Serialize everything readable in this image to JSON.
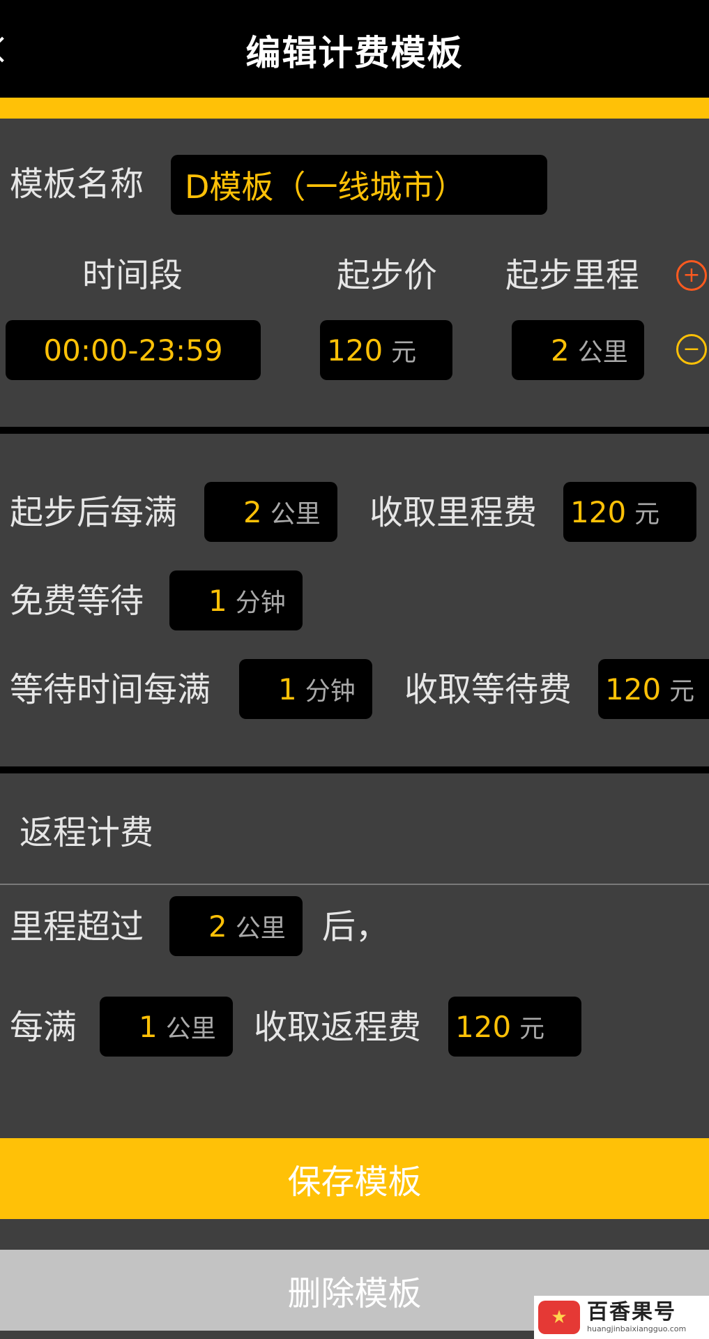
{
  "header": {
    "title": "编辑计费模板"
  },
  "template": {
    "label": "模板名称",
    "name": "D模板（一线城市）"
  },
  "columns": {
    "time": "时间段",
    "start_price": "起步价",
    "start_distance": "起步里程"
  },
  "row": {
    "time": "00:00-23:59",
    "price": "120",
    "price_unit": "元",
    "distance": "2",
    "distance_unit": "公里",
    "add": "+",
    "remove": "−"
  },
  "mileage": {
    "label": "起步后每满",
    "value": "2",
    "unit": "公里",
    "fee_label": "收取里程费",
    "fee": "120",
    "fee_unit": "元"
  },
  "free_wait": {
    "label": "免费等待",
    "value": "1",
    "unit": "分钟"
  },
  "wait": {
    "label": "等待时间每满",
    "value": "1",
    "unit": "分钟",
    "fee_label": "收取等待费",
    "fee": "120",
    "fee_unit": "元"
  },
  "return_trip": {
    "title": "返程计费",
    "over_label": "里程超过",
    "over_value": "2",
    "over_unit": "公里",
    "after_text": "后，",
    "each_label": "每满",
    "each_value": "1",
    "each_unit": "公里",
    "fee_label": "收取返程费",
    "fee": "120",
    "fee_unit": "元"
  },
  "actions": {
    "save": "保存模板",
    "delete": "删除模板"
  },
  "watermark": {
    "name": "百香果号",
    "url": "huangjinbaixiangguo.com"
  }
}
